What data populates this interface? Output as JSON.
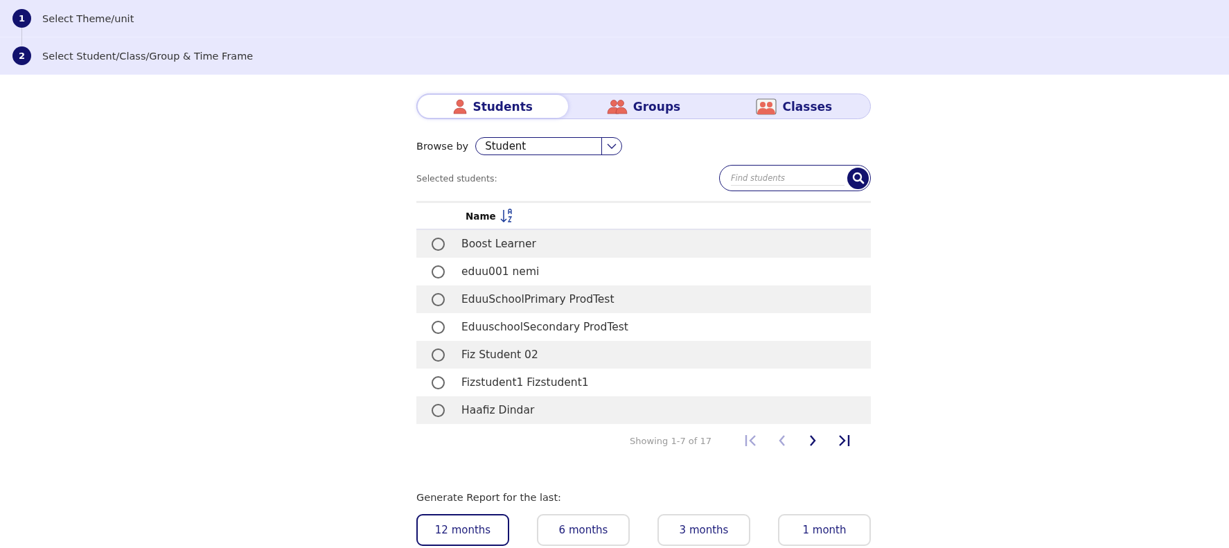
{
  "steps": [
    {
      "number": "1",
      "label": "Select Theme/unit"
    },
    {
      "number": "2",
      "label": "Select Student/Class/Group & Time Frame"
    }
  ],
  "tabs": [
    {
      "label": "Students",
      "kind": "student",
      "selected": true
    },
    {
      "label": "Groups",
      "kind": "group",
      "selected": false
    },
    {
      "label": "Classes",
      "kind": "class",
      "selected": false
    }
  ],
  "browse": {
    "label": "Browse by",
    "value": "Student"
  },
  "selected_label": "Selected students:",
  "search": {
    "placeholder": "Find students"
  },
  "table": {
    "columns": [
      {
        "label": "Name",
        "sorted": true
      }
    ],
    "rows": [
      {
        "name": "Boost Learner",
        "checked": false
      },
      {
        "name": "eduu001 nemi",
        "checked": false
      },
      {
        "name": "EduuSchoolPrimary ProdTest",
        "checked": false
      },
      {
        "name": "EduuschoolSecondary ProdTest",
        "checked": false
      },
      {
        "name": "Fiz Student 02",
        "checked": false
      },
      {
        "name": "Fizstudent1 Fizstudent1",
        "checked": false
      },
      {
        "name": "Haafiz Dindar",
        "checked": false
      }
    ]
  },
  "pagination": {
    "text": "Showing 1-7 of 17",
    "buttons": [
      {
        "kind": "first",
        "disabled": true
      },
      {
        "kind": "prev",
        "disabled": true
      },
      {
        "kind": "next",
        "disabled": false
      },
      {
        "kind": "last",
        "disabled": false
      }
    ]
  },
  "time_frame": {
    "label": "Generate Report for the last:",
    "options": [
      {
        "label": "12 months",
        "selected": true
      },
      {
        "label": "6 months",
        "selected": false
      },
      {
        "label": "3 months",
        "selected": false
      },
      {
        "label": "1 month",
        "selected": false
      }
    ]
  }
}
